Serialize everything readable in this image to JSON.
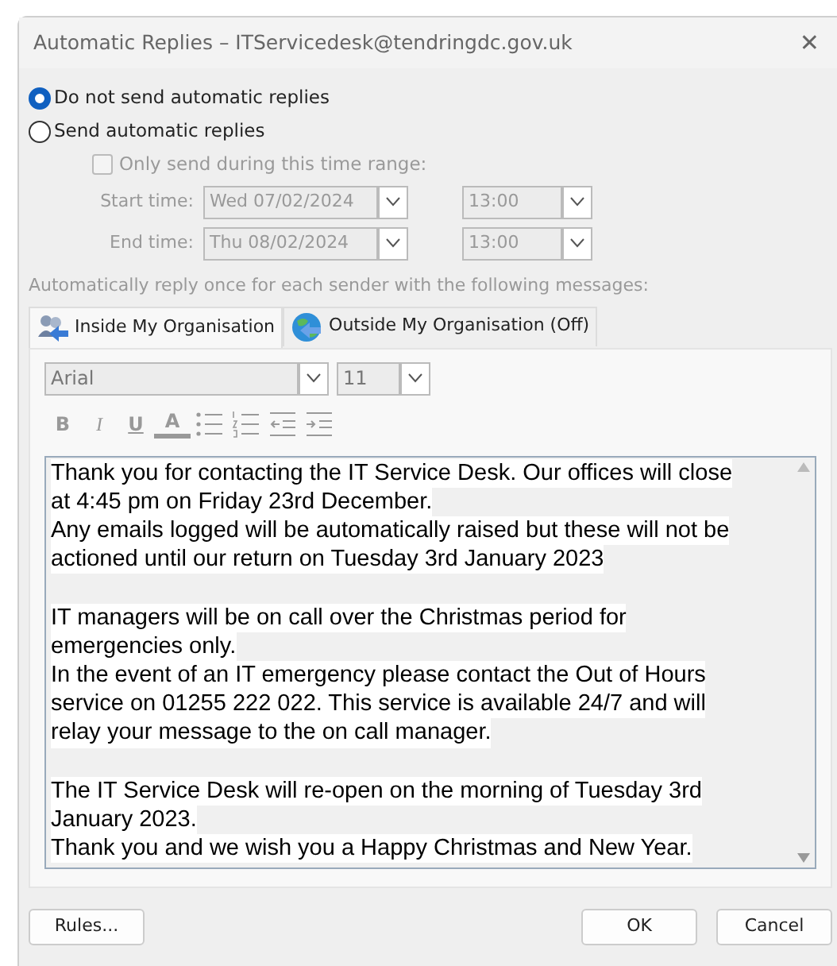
{
  "window": {
    "title": "Automatic Replies – ITServicedesk@tendringdc.gov.uk",
    "close": "✕"
  },
  "reply_mode": [
    {
      "label": "Do not send automatic replies",
      "selected": true
    },
    {
      "label": "Send automatic replies",
      "selected": false
    }
  ],
  "time_range": {
    "label": "Only send during this time range:",
    "checked": false,
    "disabled": true,
    "rows": [
      {
        "label": "Start time:",
        "date": "Wed 07/02/2024",
        "time": "13:00"
      },
      {
        "label": "End time:",
        "date": "Thu 08/02/2024",
        "time": "13:00"
      }
    ]
  },
  "hint": "Automatically reply once for each sender with the following messages:",
  "tabs": [
    {
      "label": "Inside My Organisation",
      "kind": "people",
      "selected": true
    },
    {
      "label": "Outside My Organisation (Off)",
      "kind": "globe",
      "selected": false
    }
  ],
  "editor": {
    "font": "Arial",
    "size": "11",
    "toolbar": [
      {
        "kind": "bold",
        "label": "B"
      },
      {
        "kind": "italic",
        "label": "I"
      },
      {
        "kind": "underline",
        "label": "U"
      },
      {
        "kind": "color",
        "label": "A"
      },
      {
        "kind": "bullets"
      },
      {
        "kind": "numbers"
      },
      {
        "kind": "outdent"
      },
      {
        "kind": "indent"
      }
    ],
    "lines": [
      {
        "kind": "text",
        "text": "Thank you for contacting the IT Service Desk. Our offices will close"
      },
      {
        "kind": "text",
        "text": "at 4:45 pm on Friday 23rd December."
      },
      {
        "kind": "text",
        "text": "Any emails logged will be automatically raised but these will not be"
      },
      {
        "kind": "text",
        "text": "actioned until our return on Tuesday 3rd January 2023"
      },
      {
        "kind": "blank"
      },
      {
        "kind": "text",
        "text": "IT managers will be on call over the Christmas period for"
      },
      {
        "kind": "text",
        "text": "emergencies only."
      },
      {
        "kind": "text",
        "text": "In the event of an IT emergency please contact the Out of Hours"
      },
      {
        "kind": "text",
        "text": "service on 01255 222 022. This service is available 24/7 and will"
      },
      {
        "kind": "text",
        "text": "relay your message to the on call manager."
      },
      {
        "kind": "blank"
      },
      {
        "kind": "text",
        "text": "The IT Service Desk will re-open on the morning of Tuesday 3rd"
      },
      {
        "kind": "text",
        "text": "January 2023."
      },
      {
        "kind": "text",
        "text": "Thank you and we wish you a Happy Christmas and New Year."
      }
    ]
  },
  "buttons": {
    "rules": "Rules...",
    "ok": "OK",
    "cancel": "Cancel"
  }
}
